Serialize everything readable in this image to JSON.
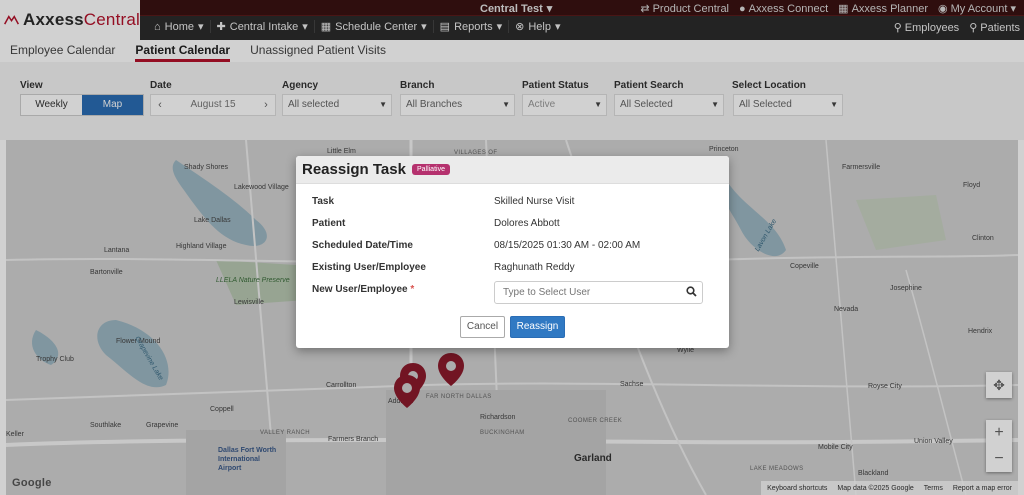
{
  "brand": {
    "name_part1": "Axxess",
    "name_part2": "Central"
  },
  "environment": "Central Test",
  "top_links": [
    "Product Central",
    "Axxess Connect",
    "Axxess Planner",
    "My Account"
  ],
  "main_nav": [
    "Home",
    "Central Intake",
    "Schedule Center",
    "Reports",
    "Help"
  ],
  "right_nav": [
    "Employees",
    "Patients"
  ],
  "tabs": [
    "Employee Calendar",
    "Patient Calendar",
    "Unassigned Patient Visits"
  ],
  "filters": {
    "view": {
      "label": "View",
      "options": [
        "Weekly",
        "Map"
      ],
      "selected": "Map"
    },
    "date": {
      "label": "Date",
      "value": "August 15"
    },
    "agency": {
      "label": "Agency",
      "value": "All selected"
    },
    "branch": {
      "label": "Branch",
      "value": "All Branches"
    },
    "patient_status": {
      "label": "Patient Status",
      "value": "Active"
    },
    "patient_search": {
      "label": "Patient Search",
      "value": "All Selected"
    },
    "select_location": {
      "label": "Select Location",
      "value": "All Selected"
    }
  },
  "map": {
    "labels": [
      "Little Elm",
      "Shady Shores",
      "Lakewood Village",
      "Lake Dallas",
      "Highland Village",
      "Lantana",
      "Bartonville",
      "LLELA Nature Preserve",
      "Lewisville",
      "Flower Mound",
      "Trophy Club",
      "Grapevine Lake",
      "Southlake",
      "Grapevine",
      "Coppell",
      "Carrollton",
      "Addison",
      "FAR NORTH DALLAS",
      "Richardson",
      "COOMER CREEK",
      "VALLEY RANCH",
      "Farmers Branch",
      "BUCKINGHAM",
      "Garland",
      "Keller",
      "Dallas Fort Worth International Airport",
      "VILLAGES OF",
      "Princeton",
      "Farmersville",
      "Floyd",
      "Lavon Lake",
      "Clinton",
      "Copeville",
      "Josephine",
      "Nevada",
      "Hendrix",
      "Wylie",
      "Sachse",
      "Royse City",
      "Union Valley",
      "Mobile City",
      "Blackland",
      "LAKE MEADOWS"
    ],
    "keyboard_shortcuts": "Keyboard shortcuts",
    "map_data": "Map data ©2025 Google",
    "terms": "Terms",
    "report_error": "Report a map error",
    "logo": "Google"
  },
  "modal": {
    "title": "Reassign Task",
    "badge": "Palliative",
    "task_label": "Task",
    "task_value": "Skilled Nurse Visit",
    "patient_label": "Patient",
    "patient_value": "Dolores Abbott",
    "scheduled_label": "Scheduled Date/Time",
    "scheduled_value": "08/15/2025 01:30 AM - 02:00 AM",
    "existing_label": "Existing User/Employee",
    "existing_value": "Raghunath Reddy",
    "new_label": "New User/Employee",
    "required_mark": "*",
    "new_placeholder": "Type to Select User",
    "cancel": "Cancel",
    "reassign": "Reassign"
  },
  "colors": {
    "brand_red": "#b5122b",
    "primary_blue": "#3079c3",
    "badge_magenta": "#b5316e",
    "pin_red": "#8b1a2b"
  }
}
